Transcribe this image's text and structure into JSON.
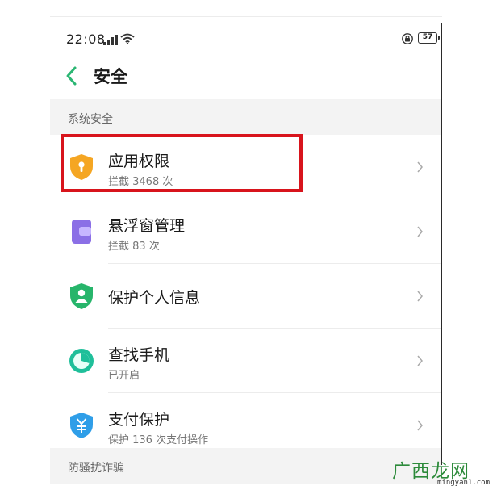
{
  "status_bar": {
    "time": "22:08",
    "battery": "57",
    "icons": [
      "signal-icon",
      "wifi-icon",
      "lock-icon",
      "battery-icon"
    ]
  },
  "header": {
    "back_icon": "chevron-left-icon",
    "title": "安全"
  },
  "sections": [
    {
      "title": "系统安全",
      "items": [
        {
          "title": "应用权限",
          "subtitle": "拦截 3468 次",
          "icon": "shield-icon",
          "icon_color": "#f5a623"
        },
        {
          "title": "悬浮窗管理",
          "subtitle": "拦截 83 次",
          "icon": "floating-window-icon",
          "icon_color": "#8b6fe6"
        },
        {
          "title": "保护个人信息",
          "subtitle": "",
          "icon": "user-shield-icon",
          "icon_color": "#27b56b"
        },
        {
          "title": "查找手机",
          "subtitle": "已开启",
          "icon": "find-phone-icon",
          "icon_color": "#1fbf9a"
        },
        {
          "title": "支付保护",
          "subtitle": "保护 136 次支付操作",
          "icon": "payment-shield-icon",
          "icon_color": "#2f9ee8"
        }
      ]
    },
    {
      "title": "防骚扰诈骗",
      "items": []
    }
  ],
  "colors": {
    "accent": "#2bb673",
    "highlight": "#d8141c"
  },
  "watermark": {
    "text": "广西龙网",
    "url": "mingyan1.com"
  }
}
